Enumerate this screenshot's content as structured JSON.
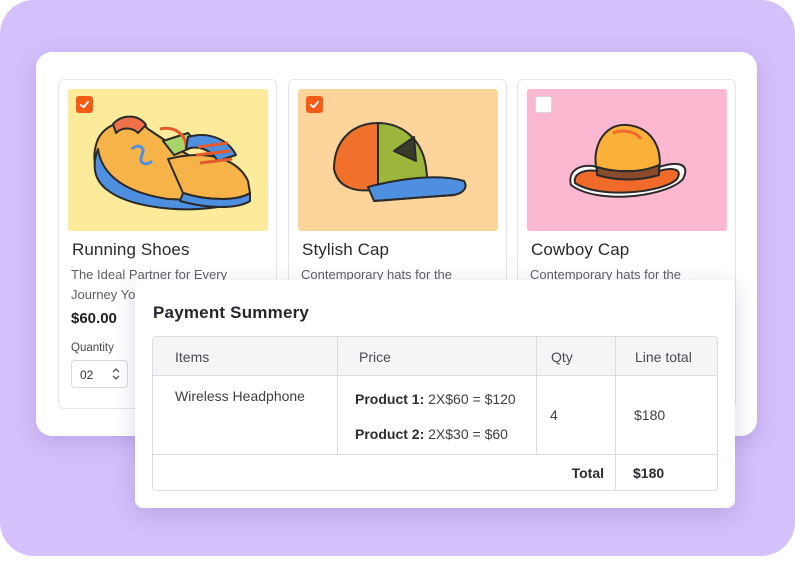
{
  "colors": {
    "background": "#d4c0fb",
    "accent": "#f25c14"
  },
  "products": [
    {
      "title": "Running Shoes",
      "description": "The Ideal Partner for Every Journey Yo",
      "price": "$60.00",
      "quantity_label": "Quantity",
      "quantity_value": "02",
      "checked": true,
      "image_bg": "#fdeb9c",
      "icon": "sneaker-icon"
    },
    {
      "title": "Stylish Cap",
      "description": "Contemporary hats for the",
      "checked": true,
      "image_bg": "#fdd49c",
      "icon": "cap-icon"
    },
    {
      "title": "Cowboy Cap",
      "description": "Contemporary hats for the",
      "checked": false,
      "image_bg": "#fdb8d1",
      "icon": "cowboy-hat-icon"
    }
  ],
  "payment_summary": {
    "title": "Payment Summery",
    "headers": [
      "Items",
      "Price",
      "Qty",
      "Line total"
    ],
    "row": {
      "item": "Wireless Headphone",
      "price_lines": [
        {
          "label": "Product 1:",
          "value": "2X$60 = $120"
        },
        {
          "label": "Product 2:",
          "value": "2X$30 = $60"
        }
      ],
      "qty": "4",
      "line_total": "$180"
    },
    "total_label": "Total",
    "total_value": "$180"
  }
}
